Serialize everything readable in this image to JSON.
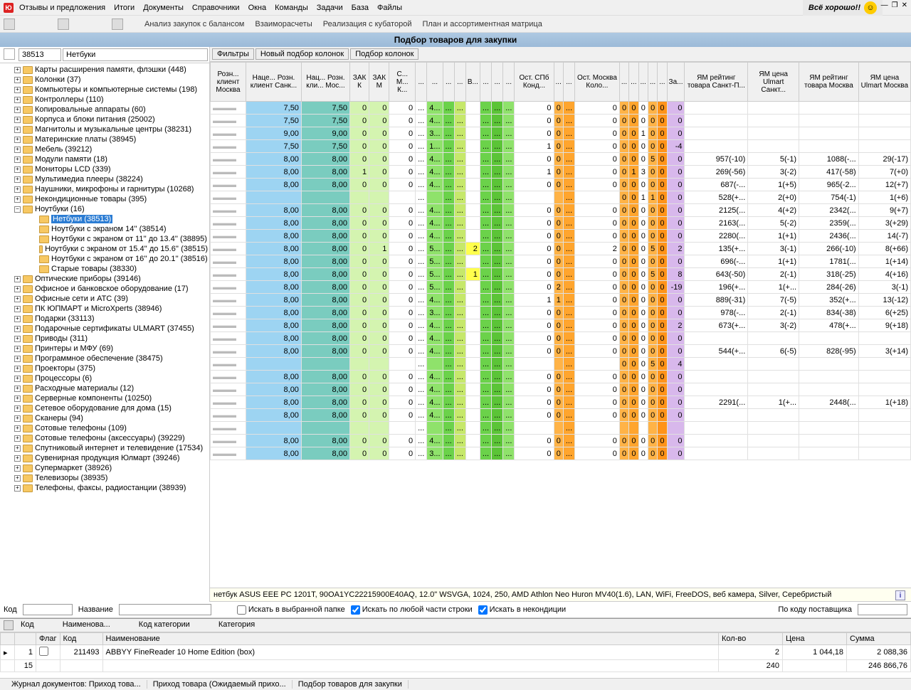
{
  "menu": [
    "Отзывы и предложения",
    "Итоги",
    "Документы",
    "Справочники",
    "Окна",
    "Команды",
    "Задачи",
    "База",
    "Файлы"
  ],
  "banner": "Всё хорошо!!",
  "toolbar_links": [
    "Анализ закупок с балансом",
    "Взаиморасчеты",
    "Реализация с кубаторой",
    "План и ассортиментная матрица"
  ],
  "page_title": "Подбор товаров для закупки",
  "side_code": "38513",
  "side_name": "Нетбуки",
  "tree": [
    {
      "l": "Карты расширения памяти, флэшки (448)"
    },
    {
      "l": "Колонки (37)"
    },
    {
      "l": "Компьютеры и компьютерные системы (198)"
    },
    {
      "l": "Контроллеры (110)"
    },
    {
      "l": "Копировальные аппараты (60)"
    },
    {
      "l": "Корпуса и блоки питания (25002)"
    },
    {
      "l": "Магнитолы и музыкальные центры (38231)"
    },
    {
      "l": "Материнские платы (38945)"
    },
    {
      "l": "Мебель (39212)"
    },
    {
      "l": "Модули памяти (18)"
    },
    {
      "l": "Мониторы LCD (339)"
    },
    {
      "l": "Мультимедиа плееры (38224)"
    },
    {
      "l": "Наушники, микрофоны и гарнитуры  (10268)"
    },
    {
      "l": "Некондиционные товары (395)"
    },
    {
      "l": "Ноутбуки (16)",
      "open": true
    },
    {
      "l": "Нетбуки (38513)",
      "child": true,
      "selected": true
    },
    {
      "l": "Ноутбуки с экраном 14'' (38514)",
      "child": true
    },
    {
      "l": "Ноутбуки с экраном от 11'' до 13.4'' (38895)",
      "child": true
    },
    {
      "l": "Ноутбуки с экраном от 15.4'' до 15.6'' (38515)",
      "child": true
    },
    {
      "l": "Ноутбуки с экраном от 16'' до 20.1'' (38516)",
      "child": true
    },
    {
      "l": "Старые товары (38330)",
      "child": true
    },
    {
      "l": "Оптические приборы (39146)"
    },
    {
      "l": "Офисное и банковское оборудование (17)"
    },
    {
      "l": "Офисные сети и АТС (39)"
    },
    {
      "l": "ПК ЮПМАРТ и MicroXperts (38946)"
    },
    {
      "l": "Подарки (33113)"
    },
    {
      "l": "Подарочные сертификаты ULMART (37455)"
    },
    {
      "l": "Приводы (311)"
    },
    {
      "l": "Принтеры и МФУ (69)"
    },
    {
      "l": "Программное обеспечение (38475)"
    },
    {
      "l": "Проекторы (375)"
    },
    {
      "l": "Процессоры (6)"
    },
    {
      "l": "Расходные материалы (12)"
    },
    {
      "l": "Серверные компоненты (10250)"
    },
    {
      "l": "Сетевое оборудование для дома (15)"
    },
    {
      "l": "Сканеры (94)"
    },
    {
      "l": "Сотовые телефоны (109)"
    },
    {
      "l": "Сотовые телефоны (аксессуары) (39229)"
    },
    {
      "l": "Спутниковый интернет и телевидение (17534)"
    },
    {
      "l": "Сувенирная продукция Юлмарт (39246)"
    },
    {
      "l": "Супермаркет (38926)"
    },
    {
      "l": "Телевизоры (38935)"
    },
    {
      "l": "Телефоны, факсы, радиостанции (38939)"
    }
  ],
  "filter_btns": [
    "Фильтры",
    "Новый подбор колонок",
    "Подбор колонок"
  ],
  "columns": [
    "Розн... клиент Москва",
    "Наце... Розн. клиент Санк...",
    "Нац... Розн. кли... Мос...",
    "ЗАК К",
    "ЗАК М",
    "С... М... К...",
    "...",
    "...",
    "...",
    "...",
    "В...",
    "...",
    "...",
    "...",
    "Ост. СПб Конд...",
    "...",
    "...",
    "Ост. Москва Коло...",
    "...",
    "...",
    "...",
    "...",
    "...",
    "За...",
    "ЯМ рейтинг товара Санкт-П...",
    "ЯМ цена Ulmart Санкт...",
    "ЯМ рейтинг товара Москва",
    "ЯМ цена Ulmart Москва"
  ],
  "rows": [
    {
      "r1": "7,50",
      "r2": "7,50",
      "zk": "0",
      "zm": "0",
      "smk": "0",
      "c1": "4...",
      "y": "",
      "o1": "0",
      "o2": "0",
      "om": "0",
      "o3": "0",
      "o4": "0",
      "o5": "0",
      "o6": "0",
      "o7": "0",
      "za": "0"
    },
    {
      "r1": "7,50",
      "r2": "7,50",
      "zk": "0",
      "zm": "0",
      "smk": "0",
      "c1": "4...",
      "y": "",
      "o1": "0",
      "o2": "0",
      "om": "0",
      "o3": "0",
      "o4": "0",
      "o5": "0",
      "o6": "0",
      "o7": "0",
      "za": "0"
    },
    {
      "r1": "9,00",
      "r2": "9,00",
      "zk": "0",
      "zm": "0",
      "smk": "0",
      "c1": "3...",
      "y": "",
      "o1": "0",
      "o2": "0",
      "om": "0",
      "o3": "0",
      "o4": "0",
      "o5": "1",
      "o6": "0",
      "o7": "0",
      "za": "0"
    },
    {
      "r1": "7,50",
      "r2": "7,50",
      "zk": "0",
      "zm": "0",
      "smk": "0",
      "c1": "1...",
      "y": "",
      "o1": "1",
      "o2": "0",
      "om": "0",
      "o3": "0",
      "o4": "0",
      "o5": "0",
      "o6": "0",
      "o7": "0",
      "za": "-4"
    },
    {
      "r1": "8,00",
      "r2": "8,00",
      "zk": "0",
      "zm": "0",
      "smk": "0",
      "c1": "4...",
      "y": "",
      "o1": "0",
      "o2": "0",
      "om": "0",
      "o3": "0",
      "o4": "0",
      "o5": "0",
      "o6": "5",
      "o7": "0",
      "za": "0",
      "ym1": "957(-10)",
      "ym2": "5(-1)",
      "ym3": "1088(-...",
      "ym4": "29(-17)"
    },
    {
      "r1": "8,00",
      "r2": "8,00",
      "zk": "1",
      "zm": "0",
      "smk": "0",
      "c1": "4...",
      "y": "",
      "o1": "1",
      "o2": "0",
      "om": "0",
      "o3": "0",
      "o4": "1",
      "o5": "3",
      "o6": "0",
      "o7": "0",
      "za": "0",
      "ym1": "269(-56)",
      "ym2": "3(-2)",
      "ym3": "417(-58)",
      "ym4": "7(+0)"
    },
    {
      "r1": "8,00",
      "r2": "8,00",
      "zk": "0",
      "zm": "0",
      "smk": "0",
      "c1": "4...",
      "y": "",
      "o1": "0",
      "o2": "0",
      "om": "0",
      "o3": "0",
      "o4": "0",
      "o5": "0",
      "o6": "0",
      "o7": "0",
      "za": "0",
      "ym1": "687(-...",
      "ym2": "1(+5)",
      "ym3": "965(-2...",
      "ym4": "12(+7)"
    },
    {
      "r1": "",
      "r2": "",
      "zk": "",
      "zm": "",
      "smk": "",
      "c1": "",
      "y": "",
      "o1": "",
      "o2": "",
      "om": "",
      "o3": "0",
      "o4": "0",
      "o5": "1",
      "o6": "1",
      "o7": "0",
      "za": "0",
      "ym1": "528(+...",
      "ym2": "2(+0)",
      "ym3": "754(-1)",
      "ym4": "1(+6)"
    },
    {
      "r1": "8,00",
      "r2": "8,00",
      "zk": "0",
      "zm": "0",
      "smk": "0",
      "c1": "4...",
      "y": "",
      "o1": "0",
      "o2": "0",
      "om": "0",
      "o3": "0",
      "o4": "0",
      "o5": "0",
      "o6": "0",
      "o7": "0",
      "za": "0",
      "ym1": "2125(...",
      "ym2": "4(+2)",
      "ym3": "2342(...",
      "ym4": "9(+7)"
    },
    {
      "r1": "8,00",
      "r2": "8,00",
      "zk": "0",
      "zm": "0",
      "smk": "0",
      "c1": "4...",
      "y": "",
      "o1": "0",
      "o2": "0",
      "om": "0",
      "o3": "0",
      "o4": "0",
      "o5": "0",
      "o6": "0",
      "o7": "0",
      "za": "0",
      "ym1": "2163(...",
      "ym2": "5(-2)",
      "ym3": "2359(...",
      "ym4": "3(+29)"
    },
    {
      "r1": "8,00",
      "r2": "8,00",
      "zk": "0",
      "zm": "0",
      "smk": "0",
      "c1": "4...",
      "y": "",
      "o1": "0",
      "o2": "0",
      "om": "0",
      "o3": "0",
      "o4": "0",
      "o5": "0",
      "o6": "0",
      "o7": "0",
      "za": "0",
      "ym1": "2280(...",
      "ym2": "1(+1)",
      "ym3": "2436(...",
      "ym4": "14(-7)"
    },
    {
      "r1": "8,00",
      "r2": "8,00",
      "zk": "0",
      "zm": "1",
      "smk": "0",
      "c1": "5...",
      "y": "2",
      "o1": "0",
      "o2": "0",
      "om": "2",
      "o3": "0",
      "o4": "0",
      "o5": "0",
      "o6": "5",
      "o7": "0",
      "za": "2",
      "ym1": "135(+...",
      "ym2": "3(-1)",
      "ym3": "266(-10)",
      "ym4": "8(+66)"
    },
    {
      "r1": "8,00",
      "r2": "8,00",
      "zk": "0",
      "zm": "0",
      "smk": "0",
      "c1": "5...",
      "y": "",
      "o1": "0",
      "o2": "0",
      "om": "0",
      "o3": "0",
      "o4": "0",
      "o5": "0",
      "o6": "0",
      "o7": "0",
      "za": "0",
      "ym1": "696(-...",
      "ym2": "1(+1)",
      "ym3": "1781(...",
      "ym4": "1(+14)"
    },
    {
      "r1": "8,00",
      "r2": "8,00",
      "zk": "0",
      "zm": "0",
      "smk": "0",
      "c1": "5...",
      "y": "1",
      "o1": "0",
      "o2": "0",
      "om": "0",
      "o3": "0",
      "o4": "0",
      "o5": "0",
      "o6": "5",
      "o7": "0",
      "za": "8",
      "ym1": "643(-50)",
      "ym2": "2(-1)",
      "ym3": "318(-25)",
      "ym4": "4(+16)"
    },
    {
      "r1": "8,00",
      "r2": "8,00",
      "zk": "0",
      "zm": "0",
      "smk": "0",
      "c1": "5...",
      "y": "",
      "o1": "0",
      "o2": "2",
      "om": "0",
      "o3": "0",
      "o4": "0",
      "o5": "0",
      "o6": "0",
      "o7": "0",
      "za": "-19",
      "ym1": "196(+...",
      "ym2": "1(+...",
      "ym3": "284(-26)",
      "ym4": "3(-1)"
    },
    {
      "r1": "8,00",
      "r2": "8,00",
      "zk": "0",
      "zm": "0",
      "smk": "0",
      "c1": "4...",
      "y": "",
      "o1": "1",
      "o2": "1",
      "om": "0",
      "o3": "0",
      "o4": "0",
      "o5": "0",
      "o6": "0",
      "o7": "0",
      "za": "0",
      "ym1": "889(-31)",
      "ym2": "7(-5)",
      "ym3": "352(+...",
      "ym4": "13(-12)"
    },
    {
      "r1": "8,00",
      "r2": "8,00",
      "zk": "0",
      "zm": "0",
      "smk": "0",
      "c1": "3...",
      "y": "",
      "o1": "0",
      "o2": "0",
      "om": "0",
      "o3": "0",
      "o4": "0",
      "o5": "0",
      "o6": "0",
      "o7": "0",
      "za": "0",
      "ym1": "978(-...",
      "ym2": "2(-1)",
      "ym3": "834(-38)",
      "ym4": "6(+25)"
    },
    {
      "r1": "8,00",
      "r2": "8,00",
      "zk": "0",
      "zm": "0",
      "smk": "0",
      "c1": "4...",
      "y": "",
      "o1": "0",
      "o2": "0",
      "om": "0",
      "o3": "0",
      "o4": "0",
      "o5": "0",
      "o6": "0",
      "o7": "0",
      "za": "2",
      "ym1": "673(+...",
      "ym2": "3(-2)",
      "ym3": "478(+...",
      "ym4": "9(+18)"
    },
    {
      "r1": "8,00",
      "r2": "8,00",
      "zk": "0",
      "zm": "0",
      "smk": "0",
      "c1": "4...",
      "y": "",
      "o1": "0",
      "o2": "0",
      "om": "0",
      "o3": "0",
      "o4": "0",
      "o5": "0",
      "o6": "0",
      "o7": "0",
      "za": "0"
    },
    {
      "r1": "8,00",
      "r2": "8,00",
      "zk": "0",
      "zm": "0",
      "smk": "0",
      "c1": "4...",
      "y": "",
      "o1": "0",
      "o2": "0",
      "om": "0",
      "o3": "0",
      "o4": "0",
      "o5": "0",
      "o6": "0",
      "o7": "0",
      "za": "0",
      "ym1": "544(+...",
      "ym2": "6(-5)",
      "ym3": "828(-95)",
      "ym4": "3(+14)"
    },
    {
      "r1": "",
      "r2": "",
      "zk": "",
      "zm": "",
      "smk": "",
      "c1": "",
      "y": "",
      "o1": "",
      "o2": "",
      "om": "",
      "o3": "0",
      "o4": "0",
      "o5": "0",
      "o6": "5",
      "o7": "0",
      "za": "4"
    },
    {
      "r1": "8,00",
      "r2": "8,00",
      "zk": "0",
      "zm": "0",
      "smk": "0",
      "c1": "4...",
      "y": "",
      "o1": "0",
      "o2": "0",
      "om": "0",
      "o3": "0",
      "o4": "0",
      "o5": "0",
      "o6": "0",
      "o7": "0",
      "za": "0"
    },
    {
      "r1": "8,00",
      "r2": "8,00",
      "zk": "0",
      "zm": "0",
      "smk": "0",
      "c1": "4...",
      "y": "",
      "o1": "0",
      "o2": "0",
      "om": "0",
      "o3": "0",
      "o4": "0",
      "o5": "0",
      "o6": "0",
      "o7": "0",
      "za": "0"
    },
    {
      "r1": "8,00",
      "r2": "8,00",
      "zk": "0",
      "zm": "0",
      "smk": "0",
      "c1": "4...",
      "y": "",
      "o1": "0",
      "o2": "0",
      "om": "0",
      "o3": "0",
      "o4": "0",
      "o5": "0",
      "o6": "0",
      "o7": "0",
      "za": "0",
      "ym1": "2291(...",
      "ym2": "1(+...",
      "ym3": "2448(...",
      "ym4": "1(+18)"
    },
    {
      "r1": "8,00",
      "r2": "8,00",
      "zk": "0",
      "zm": "0",
      "smk": "0",
      "c1": "4...",
      "y": "",
      "o1": "0",
      "o2": "0",
      "om": "0",
      "o3": "0",
      "o4": "0",
      "o5": "0",
      "o6": "0",
      "o7": "0",
      "za": "0"
    },
    {
      "r1": "",
      "r2": "",
      "zk": "",
      "zm": "",
      "smk": "",
      "c1": "",
      "y": "",
      "o1": "",
      "o2": "",
      "om": "",
      "o3": "",
      "o4": "",
      "o5": "",
      "o6": "",
      "o7": "",
      "za": ""
    },
    {
      "r1": "8,00",
      "r2": "8,00",
      "zk": "0",
      "zm": "0",
      "smk": "0",
      "c1": "4...",
      "y": "",
      "o1": "0",
      "o2": "0",
      "om": "0",
      "o3": "0",
      "o4": "0",
      "o5": "0",
      "o6": "0",
      "o7": "0",
      "za": "0"
    },
    {
      "r1": "8,00",
      "r2": "8,00",
      "zk": "0",
      "zm": "0",
      "smk": "0",
      "c1": "3...",
      "y": "",
      "o1": "0",
      "o2": "0",
      "om": "0",
      "o3": "0",
      "o4": "0",
      "o5": "0",
      "o6": "0",
      "o7": "0",
      "za": "0"
    }
  ],
  "description": "нетбук ASUS EEE PC 1201T, 90OA1YC22215900E40AQ, 12.0\" WSVGA, 1024, 250, AMD Athlon Neo Huron MV40(1.6), LAN, WiFi, FreeDOS, веб камера, Silver, Серебристый",
  "search": {
    "kod_label": "Код",
    "name_label": "Название",
    "cb1": "Искать в выбранной папке",
    "cb2": "Искать по любой части строки",
    "cb3": "Искать в некондиции",
    "supplier": "По коду поставщика"
  },
  "cart_cols": [
    "",
    "",
    "Флаг",
    "Код",
    "Наименование",
    "Кол-во",
    "Цена",
    "Сумма"
  ],
  "cart_rows": [
    {
      "n": "1",
      "code": "211493",
      "name": "ABBYY FineReader 10 Home Edition (box)",
      "qty": "2",
      "price": "1 044,18",
      "sum": "2 088,36"
    }
  ],
  "cart_totals": {
    "n": "15",
    "qty": "240",
    "sum": "246 866,76"
  },
  "cart_header_cols": [
    "Код",
    "Наименова...",
    "Код категории",
    "Категория"
  ],
  "status": [
    "Журнал документов: Приход това...",
    "Приход товара (Ожидаемый прихо...",
    "Подбор товаров для закупки"
  ]
}
